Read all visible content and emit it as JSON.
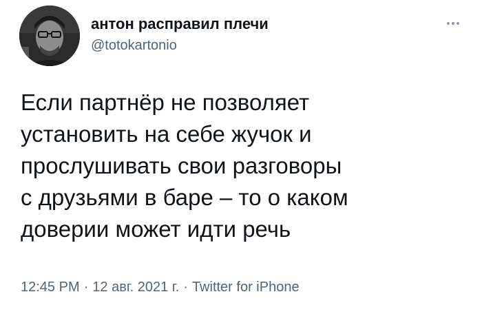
{
  "author": {
    "display_name": "антон расправил плечи",
    "handle": "@totokartonio"
  },
  "more_menu": {
    "icon": "more-horizontal-icon"
  },
  "tweet": {
    "lines": [
      "Если партнёр не позволяет",
      "установить на себе жучок и",
      "прослушивать свои разговоры",
      "с друзьями в баре – то о каком",
      "доверии может идти речь"
    ]
  },
  "meta": {
    "time": "12:45 PM",
    "separator": "·",
    "date": "12 авг. 2021 г.",
    "source": "Twitter for iPhone"
  },
  "colors": {
    "text": "#0f1419",
    "secondary": "#536471",
    "background": "#ffffff"
  }
}
